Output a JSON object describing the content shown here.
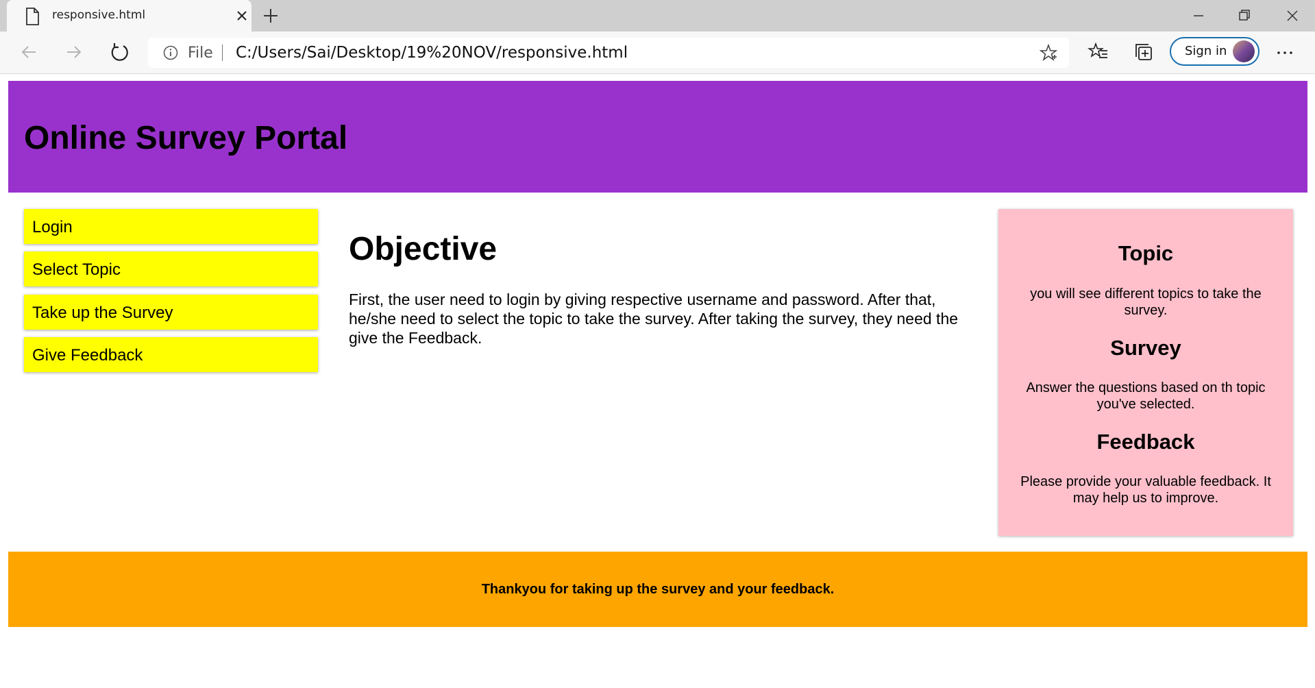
{
  "browser": {
    "tab_title": "responsive.html",
    "file_label": "File",
    "url": "C:/Users/Sai/Desktop/19%20NOV/responsive.html",
    "signin_label": "Sign in",
    "icons": [
      "document-icon",
      "close-icon",
      "plus-icon",
      "minimize-icon",
      "restore-icon",
      "window-close-icon",
      "back-icon",
      "forward-icon",
      "refresh-icon",
      "info-icon",
      "star-icon",
      "favorites-icon",
      "collections-icon",
      "more-icon"
    ]
  },
  "page": {
    "header": {
      "title": "Online Survey Portal"
    },
    "menu": [
      {
        "label": "Login"
      },
      {
        "label": "Select Topic"
      },
      {
        "label": "Take up the Survey"
      },
      {
        "label": "Give Feedback"
      }
    ],
    "main": {
      "heading": "Objective",
      "text": "First, the user need to login by giving respective username and password. After that, he/she need to select the topic to take the survey. After taking the survey, they need the give the Feedback."
    },
    "aside": [
      {
        "heading": "Topic",
        "text": "you will see different topics to take the survey."
      },
      {
        "heading": "Survey",
        "text": "Answer the questions based on th topic you've selected."
      },
      {
        "heading": "Feedback",
        "text": "Please provide your valuable feedback. It may help us to improve."
      }
    ],
    "footer": {
      "text": "Thankyou for taking up the survey and your feedback."
    }
  },
  "colors": {
    "header": "#9932cc",
    "menu": "#ffff00",
    "aside": "#ffc0cb",
    "footer": "#ffa500",
    "signin_border": "#1a6fb0"
  }
}
